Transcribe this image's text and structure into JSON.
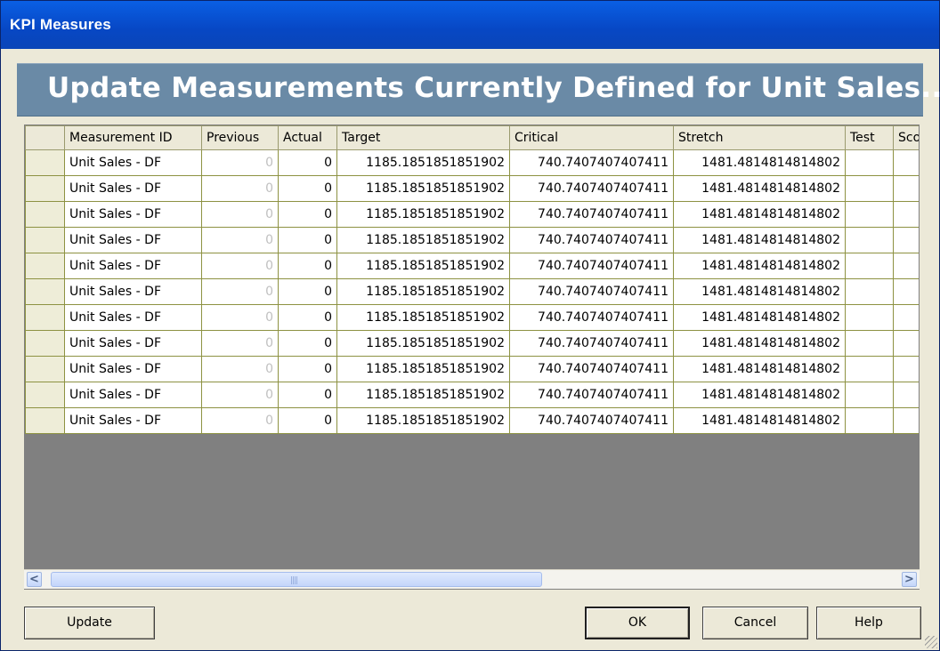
{
  "window": {
    "title": "KPI Measures"
  },
  "banner": {
    "heading": "Update Measurements Currently Defined for Unit Sales..."
  },
  "grid": {
    "columns": [
      "",
      "Measurement ID",
      "Previous",
      "Actual",
      "Target",
      "Critical",
      "Stretch",
      "Test",
      "Scor"
    ],
    "rows": [
      {
        "id": "Unit Sales - DF",
        "previous": "0",
        "actual": "0",
        "target": "1185.1851851851902",
        "critical": "740.7407407407411",
        "stretch": "1481.4814814814802"
      },
      {
        "id": "Unit Sales - DF",
        "previous": "0",
        "actual": "0",
        "target": "1185.1851851851902",
        "critical": "740.7407407407411",
        "stretch": "1481.4814814814802"
      },
      {
        "id": "Unit Sales - DF",
        "previous": "0",
        "actual": "0",
        "target": "1185.1851851851902",
        "critical": "740.7407407407411",
        "stretch": "1481.4814814814802"
      },
      {
        "id": "Unit Sales - DF",
        "previous": "0",
        "actual": "0",
        "target": "1185.1851851851902",
        "critical": "740.7407407407411",
        "stretch": "1481.4814814814802"
      },
      {
        "id": "Unit Sales - DF",
        "previous": "0",
        "actual": "0",
        "target": "1185.1851851851902",
        "critical": "740.7407407407411",
        "stretch": "1481.4814814814802"
      },
      {
        "id": "Unit Sales - DF",
        "previous": "0",
        "actual": "0",
        "target": "1185.1851851851902",
        "critical": "740.7407407407411",
        "stretch": "1481.4814814814802"
      },
      {
        "id": "Unit Sales - DF",
        "previous": "0",
        "actual": "0",
        "target": "1185.1851851851902",
        "critical": "740.7407407407411",
        "stretch": "1481.4814814814802"
      },
      {
        "id": "Unit Sales - DF",
        "previous": "0",
        "actual": "0",
        "target": "1185.1851851851902",
        "critical": "740.7407407407411",
        "stretch": "1481.4814814814802"
      },
      {
        "id": "Unit Sales - DF",
        "previous": "0",
        "actual": "0",
        "target": "1185.1851851851902",
        "critical": "740.7407407407411",
        "stretch": "1481.4814814814802"
      },
      {
        "id": "Unit Sales - DF",
        "previous": "0",
        "actual": "0",
        "target": "1185.1851851851902",
        "critical": "740.7407407407411",
        "stretch": "1481.4814814814802"
      },
      {
        "id": "Unit Sales - DF",
        "previous": "0",
        "actual": "0",
        "target": "1185.1851851851902",
        "critical": "740.7407407407411",
        "stretch": "1481.4814814814802"
      }
    ]
  },
  "scrollbar": {
    "left_icon": "scroll-left-arrow-icon",
    "right_icon": "scroll-right-arrow-icon",
    "left_glyph": "<",
    "right_glyph": ">",
    "grip": "||||"
  },
  "buttons": {
    "update": "Update",
    "ok": "OK",
    "cancel": "Cancel",
    "help": "Help"
  },
  "colors": {
    "title_bar": "#0a5fe4",
    "banner": "#6a8aa6",
    "grid_border": "#8d9242",
    "selector_column": "#eeedd8",
    "empty_area": "#808080"
  }
}
